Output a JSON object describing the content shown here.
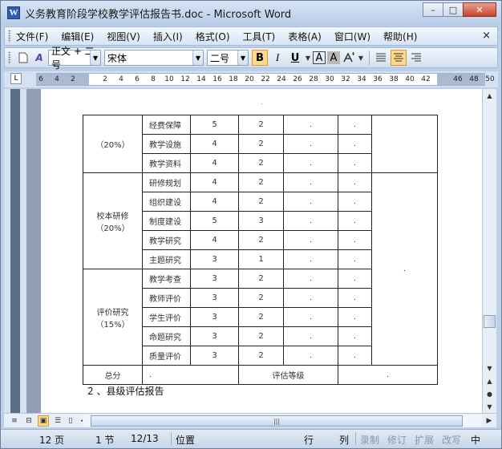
{
  "window": {
    "title": "义务教育阶段学校教学评估报告书.doc - Microsoft Word",
    "app_icon_letter": "W",
    "minimize": "–",
    "maximize": "□",
    "close": "✕"
  },
  "menu": {
    "items": [
      "文件(F)",
      "编辑(E)",
      "视图(V)",
      "插入(I)",
      "格式(O)",
      "工具(T)",
      "表格(A)",
      "窗口(W)",
      "帮助(H)"
    ],
    "close": "×"
  },
  "toolbar": {
    "style_value": "正文 + 二号",
    "font_value": "宋体",
    "size_value": "二号",
    "bold": "B",
    "italic": "I",
    "underline": "U",
    "char_border": "A",
    "char_shading": "A"
  },
  "ruler": {
    "ticks": [
      "6",
      "4",
      "2",
      "",
      "2",
      "4",
      "6",
      "8",
      "10",
      "12",
      "14",
      "16",
      "18",
      "20",
      "22",
      "24",
      "26",
      "28",
      "30",
      "32",
      "34",
      "36",
      "38",
      "40",
      "42",
      "",
      "46",
      "48",
      "50"
    ]
  },
  "table": {
    "rows": [
      {
        "group": "（20%）",
        "item": "经费保障",
        "score": "5",
        "weight": "2"
      },
      {
        "group": "",
        "item": "教学设施",
        "score": "4",
        "weight": "2"
      },
      {
        "group": "",
        "item": "教学资料",
        "score": "4",
        "weight": "2"
      },
      {
        "group": "校本研修（20%）",
        "item": "研修规划",
        "score": "4",
        "weight": "2"
      },
      {
        "group": "",
        "item": "组织建设",
        "score": "4",
        "weight": "2"
      },
      {
        "group": "",
        "item": "制度建设",
        "score": "5",
        "weight": "3"
      },
      {
        "group": "",
        "item": "教学研究",
        "score": "4",
        "weight": "2"
      },
      {
        "group": "",
        "item": "主题研究",
        "score": "3",
        "weight": "1"
      },
      {
        "group": "评价研究（15%）",
        "item": "教学考查",
        "score": "3",
        "weight": "2"
      },
      {
        "group": "",
        "item": "教师评价",
        "score": "3",
        "weight": "2"
      },
      {
        "group": "",
        "item": "学生评价",
        "score": "3",
        "weight": "2"
      },
      {
        "group": "",
        "item": "命题研究",
        "score": "3",
        "weight": "2"
      },
      {
        "group": "",
        "item": "质量评价",
        "score": "3",
        "weight": "2"
      }
    ],
    "group1_label": "（20%）",
    "group2_line1": "校本研修",
    "group2_line2": "（20%）",
    "group3_line1": "评价研究",
    "group3_line2": "（15%）",
    "total_label": "总分",
    "grade_label": "评估等级",
    "cell_mark": ".",
    "row_mark": "."
  },
  "heading": "2 、县级评估报告",
  "status": {
    "page": "12 页",
    "section": "1 节",
    "page_of": "12/13",
    "position": "位置",
    "line": "行",
    "column": "列",
    "record": "录制",
    "revision": "修订",
    "extend": "扩展",
    "overwrite": "改写",
    "language": "中"
  }
}
